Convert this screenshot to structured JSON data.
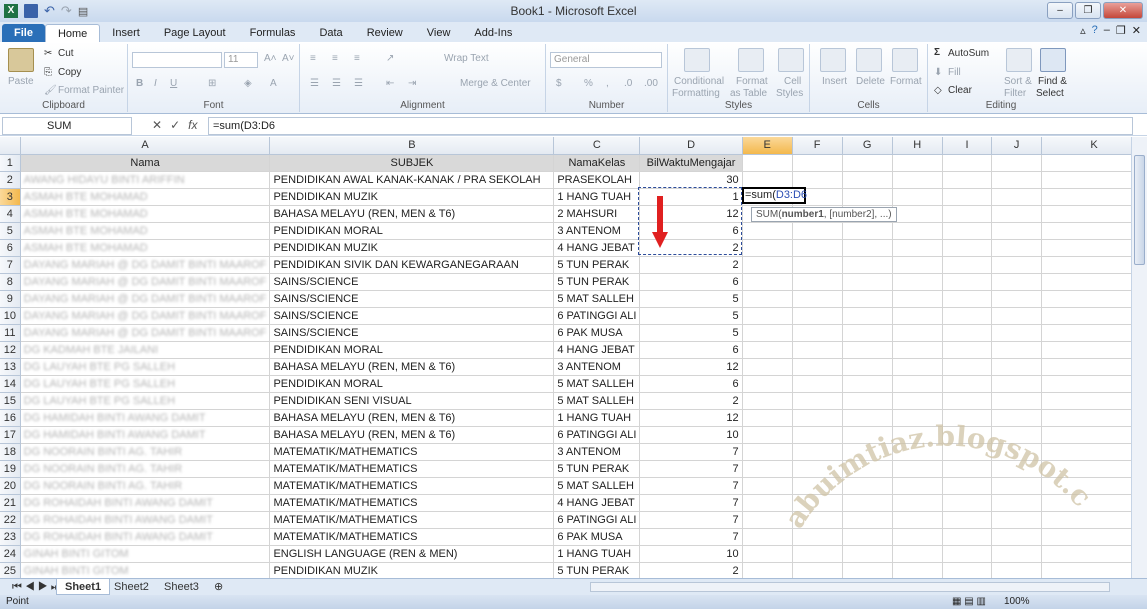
{
  "app": {
    "title": "Book1 - Microsoft Excel"
  },
  "tabs": [
    "File",
    "Home",
    "Insert",
    "Page Layout",
    "Formulas",
    "Data",
    "Review",
    "View",
    "Add-Ins"
  ],
  "ribbon": {
    "clipboard": {
      "paste": "Paste",
      "cut": "Cut",
      "copy": "Copy",
      "format_painter": "Format Painter",
      "label": "Clipboard"
    },
    "font": {
      "size": "11",
      "label": "Font"
    },
    "alignment": {
      "wrap": "Wrap Text",
      "merge": "Merge & Center",
      "label": "Alignment"
    },
    "number": {
      "format": "General",
      "label": "Number"
    },
    "styles": {
      "cond1": "Conditional",
      "cond2": "Formatting",
      "fmt1": "Format",
      "fmt2": "as Table",
      "cell1": "Cell",
      "cell2": "Styles",
      "label": "Styles"
    },
    "cells": {
      "insert": "Insert",
      "delete": "Delete",
      "format": "Format",
      "label": "Cells"
    },
    "editing": {
      "autosum": "AutoSum",
      "fill": "Fill",
      "clear": "Clear",
      "sort1": "Sort &",
      "sort2": "Filter",
      "find1": "Find &",
      "find2": "Select",
      "label": "Editing"
    }
  },
  "formula_bar": {
    "name_box": "SUM",
    "formula": "=sum(D3:D6"
  },
  "columns": [
    "A",
    "B",
    "C",
    "D",
    "E",
    "F",
    "G",
    "H",
    "I",
    "J",
    "K"
  ],
  "rows": [
    {
      "n": "1",
      "a": "Nama",
      "b": "SUBJEK",
      "c": "NamaKelas",
      "d": "BilWaktuMengajar"
    },
    {
      "n": "2",
      "a": "AWANG HIDAYU BINTI ARIFFIN",
      "b": "PENDIDIKAN AWAL KANAK-KANAK / PRA SEKOLAH",
      "c": "PRASEKOLAH",
      "d": "30"
    },
    {
      "n": "3",
      "a": "ASMAH BTE MOHAMAD",
      "b": "PENDIDIKAN MUZIK",
      "c": "1 HANG TUAH",
      "d": "1"
    },
    {
      "n": "4",
      "a": "ASMAH BTE MOHAMAD",
      "b": "BAHASA MELAYU (REN, MEN & T6)",
      "c": "2 MAHSURI",
      "d": "12"
    },
    {
      "n": "5",
      "a": "ASMAH BTE MOHAMAD",
      "b": "PENDIDIKAN MORAL",
      "c": "3 ANTENOM",
      "d": "6"
    },
    {
      "n": "6",
      "a": "ASMAH BTE MOHAMAD",
      "b": "PENDIDIKAN MUZIK",
      "c": "4 HANG JEBAT",
      "d": "2"
    },
    {
      "n": "7",
      "a": "DAYANG MARIAH @ DG DAMIT BINTI MAAROF",
      "b": "PENDIDIKAN SIVIK DAN KEWARGANEGARAAN",
      "c": "5 TUN PERAK",
      "d": "2"
    },
    {
      "n": "8",
      "a": "DAYANG MARIAH @ DG DAMIT BINTI MAAROF",
      "b": "SAINS/SCIENCE",
      "c": "5 TUN PERAK",
      "d": "6"
    },
    {
      "n": "9",
      "a": "DAYANG MARIAH @ DG DAMIT BINTI MAAROF",
      "b": "SAINS/SCIENCE",
      "c": "5 MAT SALLEH",
      "d": "5"
    },
    {
      "n": "10",
      "a": "DAYANG MARIAH @ DG DAMIT BINTI MAAROF",
      "b": "SAINS/SCIENCE",
      "c": "6 PATINGGI ALI",
      "d": "5"
    },
    {
      "n": "11",
      "a": "DAYANG MARIAH @ DG DAMIT BINTI MAAROF",
      "b": "SAINS/SCIENCE",
      "c": "6 PAK MUSA",
      "d": "5"
    },
    {
      "n": "12",
      "a": "DG KADMAH BTE JAILANI",
      "b": "PENDIDIKAN MORAL",
      "c": "4 HANG JEBAT",
      "d": "6"
    },
    {
      "n": "13",
      "a": "DG LAUYAH BTE PG SALLEH",
      "b": "BAHASA MELAYU (REN, MEN & T6)",
      "c": "3 ANTENOM",
      "d": "12"
    },
    {
      "n": "14",
      "a": "DG LAUYAH BTE PG SALLEH",
      "b": "PENDIDIKAN MORAL",
      "c": "5 MAT SALLEH",
      "d": "6"
    },
    {
      "n": "15",
      "a": "DG LAUYAH BTE PG SALLEH",
      "b": "PENDIDIKAN SENI VISUAL",
      "c": "5 MAT SALLEH",
      "d": "2"
    },
    {
      "n": "16",
      "a": "DG HAMIDAH BINTI AWANG DAMIT",
      "b": "BAHASA MELAYU (REN, MEN & T6)",
      "c": "1 HANG TUAH",
      "d": "12"
    },
    {
      "n": "17",
      "a": "DG HAMIDAH BINTI AWANG DAMIT",
      "b": "BAHASA MELAYU (REN, MEN & T6)",
      "c": "6 PATINGGI ALI",
      "d": "10"
    },
    {
      "n": "18",
      "a": "DG NOORAIN BINTI AG. TAHIR",
      "b": "MATEMATIK/MATHEMATICS",
      "c": "3 ANTENOM",
      "d": "7"
    },
    {
      "n": "19",
      "a": "DG NOORAIN BINTI AG. TAHIR",
      "b": "MATEMATIK/MATHEMATICS",
      "c": "5 TUN PERAK",
      "d": "7"
    },
    {
      "n": "20",
      "a": "DG NOORAIN BINTI AG. TAHIR",
      "b": "MATEMATIK/MATHEMATICS",
      "c": "5 MAT SALLEH",
      "d": "7"
    },
    {
      "n": "21",
      "a": "DG ROHAIDAH BINTI AWANG DAMIT",
      "b": "MATEMATIK/MATHEMATICS",
      "c": "4 HANG JEBAT",
      "d": "7"
    },
    {
      "n": "22",
      "a": "DG ROHAIDAH BINTI AWANG DAMIT",
      "b": "MATEMATIK/MATHEMATICS",
      "c": "6 PATINGGI ALI",
      "d": "7"
    },
    {
      "n": "23",
      "a": "DG ROHAIDAH BINTI AWANG DAMIT",
      "b": "MATEMATIK/MATHEMATICS",
      "c": "6 PAK MUSA",
      "d": "7"
    },
    {
      "n": "24",
      "a": "GINAH BINTI GITOM",
      "b": "ENGLISH LANGUAGE (REN & MEN)",
      "c": "1 HANG TUAH",
      "d": "10"
    },
    {
      "n": "25",
      "a": "GINAH BINTI GITOM",
      "b": "PENDIDIKAN MUZIK",
      "c": "5 TUN PERAK",
      "d": "2"
    }
  ],
  "edit_cell": {
    "formula": "=sum(",
    "ref": "D3:D6"
  },
  "tooltip": {
    "fn": "SUM(",
    "arg1": "number1",
    "rest": ", [number2], ...)"
  },
  "watermark": {
    "text": "abuimtiaz.blogspot.com"
  },
  "sheets": [
    "Sheet1",
    "Sheet2",
    "Sheet3"
  ],
  "status": {
    "mode": "Point",
    "zoom": "100%"
  }
}
